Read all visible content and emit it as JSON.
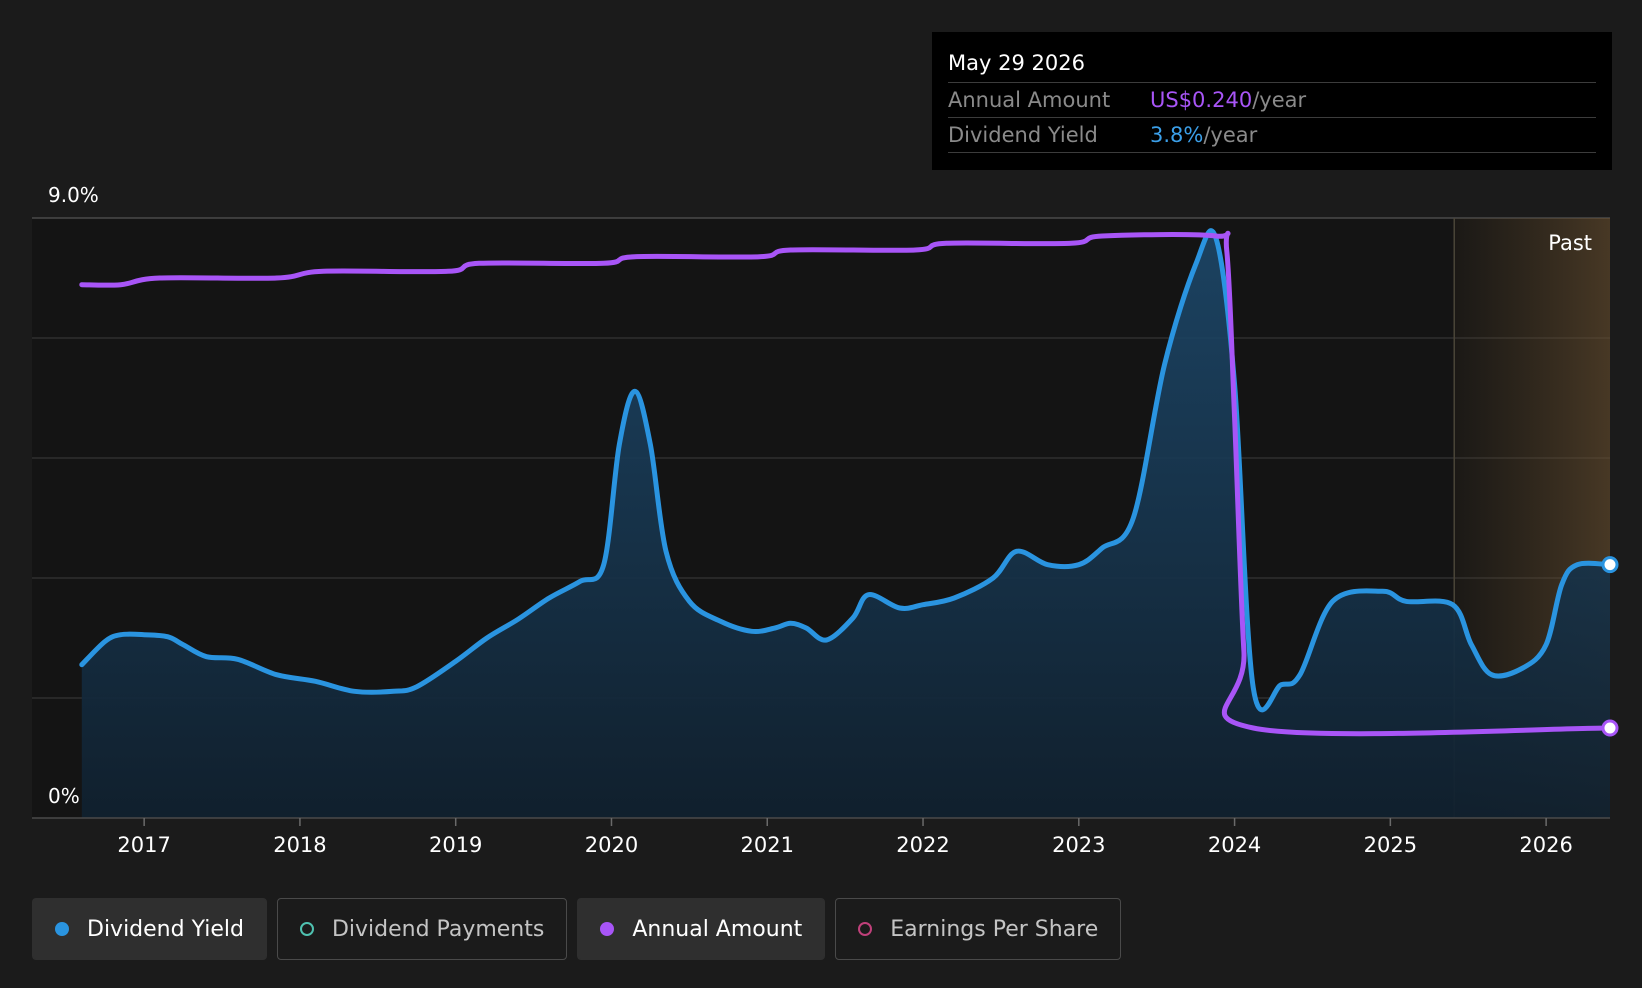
{
  "chart_data": {
    "type": "line",
    "y_axis": {
      "min_label": "0%",
      "max_label": "9.0%",
      "ylim": [
        0,
        9.0
      ]
    },
    "x_axis": {
      "ticks": [
        "2017",
        "2018",
        "2019",
        "2020",
        "2021",
        "2022",
        "2023",
        "2024",
        "2025",
        "2026"
      ],
      "xlim": [
        2016.28,
        2026.41
      ]
    },
    "past_region": {
      "label": "Past",
      "start": 2025.41
    },
    "series": [
      {
        "name": "Dividend Yield",
        "color": "#2a94e0",
        "area": true,
        "points": [
          [
            2016.6,
            2.3
          ],
          [
            2016.75,
            2.65
          ],
          [
            2016.85,
            2.75
          ],
          [
            2017.0,
            2.75
          ],
          [
            2017.15,
            2.72
          ],
          [
            2017.25,
            2.6
          ],
          [
            2017.4,
            2.42
          ],
          [
            2017.6,
            2.38
          ],
          [
            2017.85,
            2.15
          ],
          [
            2018.1,
            2.05
          ],
          [
            2018.35,
            1.9
          ],
          [
            2018.6,
            1.9
          ],
          [
            2018.75,
            1.97
          ],
          [
            2019.0,
            2.35
          ],
          [
            2019.2,
            2.7
          ],
          [
            2019.4,
            2.98
          ],
          [
            2019.6,
            3.3
          ],
          [
            2019.8,
            3.55
          ],
          [
            2019.95,
            3.8
          ],
          [
            2020.05,
            5.6
          ],
          [
            2020.15,
            6.4
          ],
          [
            2020.25,
            5.6
          ],
          [
            2020.35,
            4.0
          ],
          [
            2020.5,
            3.25
          ],
          [
            2020.7,
            2.95
          ],
          [
            2020.9,
            2.8
          ],
          [
            2021.05,
            2.85
          ],
          [
            2021.15,
            2.92
          ],
          [
            2021.25,
            2.85
          ],
          [
            2021.38,
            2.67
          ],
          [
            2021.55,
            3.0
          ],
          [
            2021.65,
            3.35
          ],
          [
            2021.85,
            3.15
          ],
          [
            2022.0,
            3.2
          ],
          [
            2022.2,
            3.3
          ],
          [
            2022.45,
            3.6
          ],
          [
            2022.6,
            4.0
          ],
          [
            2022.8,
            3.8
          ],
          [
            2023.0,
            3.8
          ],
          [
            2023.15,
            4.05
          ],
          [
            2023.35,
            4.5
          ],
          [
            2023.55,
            6.8
          ],
          [
            2023.75,
            8.3
          ],
          [
            2023.88,
            8.7
          ],
          [
            2024.0,
            6.5
          ],
          [
            2024.12,
            1.95
          ],
          [
            2024.3,
            2.0
          ],
          [
            2024.42,
            2.15
          ],
          [
            2024.63,
            3.25
          ],
          [
            2024.95,
            3.4
          ],
          [
            2025.1,
            3.25
          ],
          [
            2025.4,
            3.2
          ],
          [
            2025.52,
            2.6
          ],
          [
            2025.65,
            2.15
          ],
          [
            2025.85,
            2.25
          ],
          [
            2026.0,
            2.6
          ],
          [
            2026.1,
            3.5
          ],
          [
            2026.2,
            3.8
          ],
          [
            2026.41,
            3.8
          ]
        ]
      },
      {
        "name": "Annual Amount",
        "color": "#a855f7",
        "area": false,
        "points": [
          [
            2016.6,
            8.0
          ],
          [
            2016.85,
            8.0
          ],
          [
            2017.1,
            8.1
          ],
          [
            2017.85,
            8.1
          ],
          [
            2018.15,
            8.2
          ],
          [
            2018.95,
            8.2
          ],
          [
            2019.15,
            8.32
          ],
          [
            2019.95,
            8.32
          ],
          [
            2020.15,
            8.42
          ],
          [
            2020.95,
            8.42
          ],
          [
            2021.15,
            8.52
          ],
          [
            2021.95,
            8.52
          ],
          [
            2022.15,
            8.62
          ],
          [
            2022.95,
            8.62
          ],
          [
            2023.15,
            8.73
          ],
          [
            2023.88,
            8.73
          ],
          [
            2023.95,
            8.5
          ],
          [
            2024.0,
            6.0
          ],
          [
            2024.06,
            2.5
          ],
          [
            2024.12,
            1.35
          ],
          [
            2026.41,
            1.35
          ]
        ]
      }
    ],
    "tooltip": {
      "date": "May 29 2026",
      "rows": [
        {
          "label": "Annual Amount",
          "value": "US$0.240",
          "unit": "/year",
          "color": "#a855f7"
        },
        {
          "label": "Dividend Yield",
          "value": "3.8%",
          "unit": "/year",
          "color": "#3b9fe8"
        }
      ]
    },
    "legend": [
      {
        "label": "Dividend Yield",
        "color": "#2a94e0",
        "active": true,
        "filled": true
      },
      {
        "label": "Dividend Payments",
        "color": "#4fc1b0",
        "active": false,
        "filled": false
      },
      {
        "label": "Annual Amount",
        "color": "#a855f7",
        "active": true,
        "filled": true
      },
      {
        "label": "Earnings Per Share",
        "color": "#c0407a",
        "active": false,
        "filled": false
      }
    ]
  }
}
